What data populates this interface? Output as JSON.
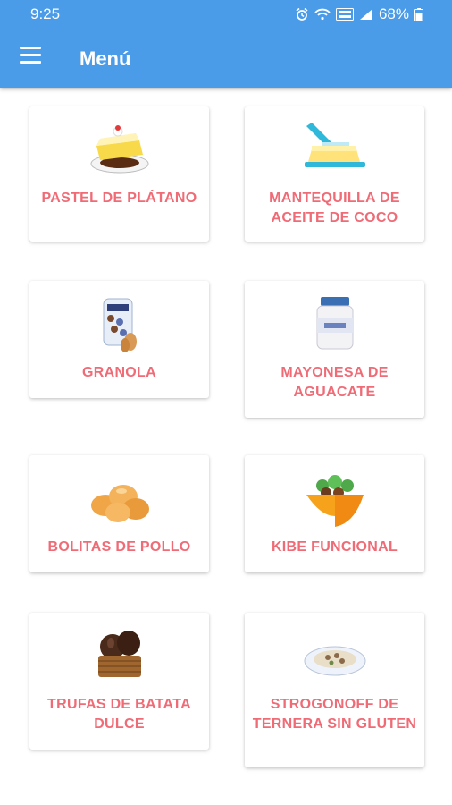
{
  "status": {
    "time": "9:25",
    "battery": "68%"
  },
  "toolbar": {
    "title": "Menú",
    "menu_icon": "hamburger-icon"
  },
  "colors": {
    "appbar": "#4a9be8",
    "label": "#ef6b76"
  },
  "recipes": [
    {
      "label": "PASTEL DE PLÁTANO",
      "icon": "cake-slice-icon"
    },
    {
      "label": "MANTEQUILLA DE ACEITE DE COCO",
      "icon": "butter-icon"
    },
    {
      "label": "GRANOLA",
      "icon": "granola-jar-icon"
    },
    {
      "label": "MAYONESA DE AGUACATE",
      "icon": "mayonnaise-jar-icon"
    },
    {
      "label": "BOLITAS DE POLLO",
      "icon": "chicken-balls-icon"
    },
    {
      "label": "KIBE FUNCIONAL",
      "icon": "kibe-bowl-icon"
    },
    {
      "label": "TRUFAS DE BATATA DULCE",
      "icon": "truffles-icon"
    },
    {
      "label": "STROGONOFF DE TERNERA SIN GLUTEN",
      "icon": "strogonoff-plate-icon"
    }
  ]
}
